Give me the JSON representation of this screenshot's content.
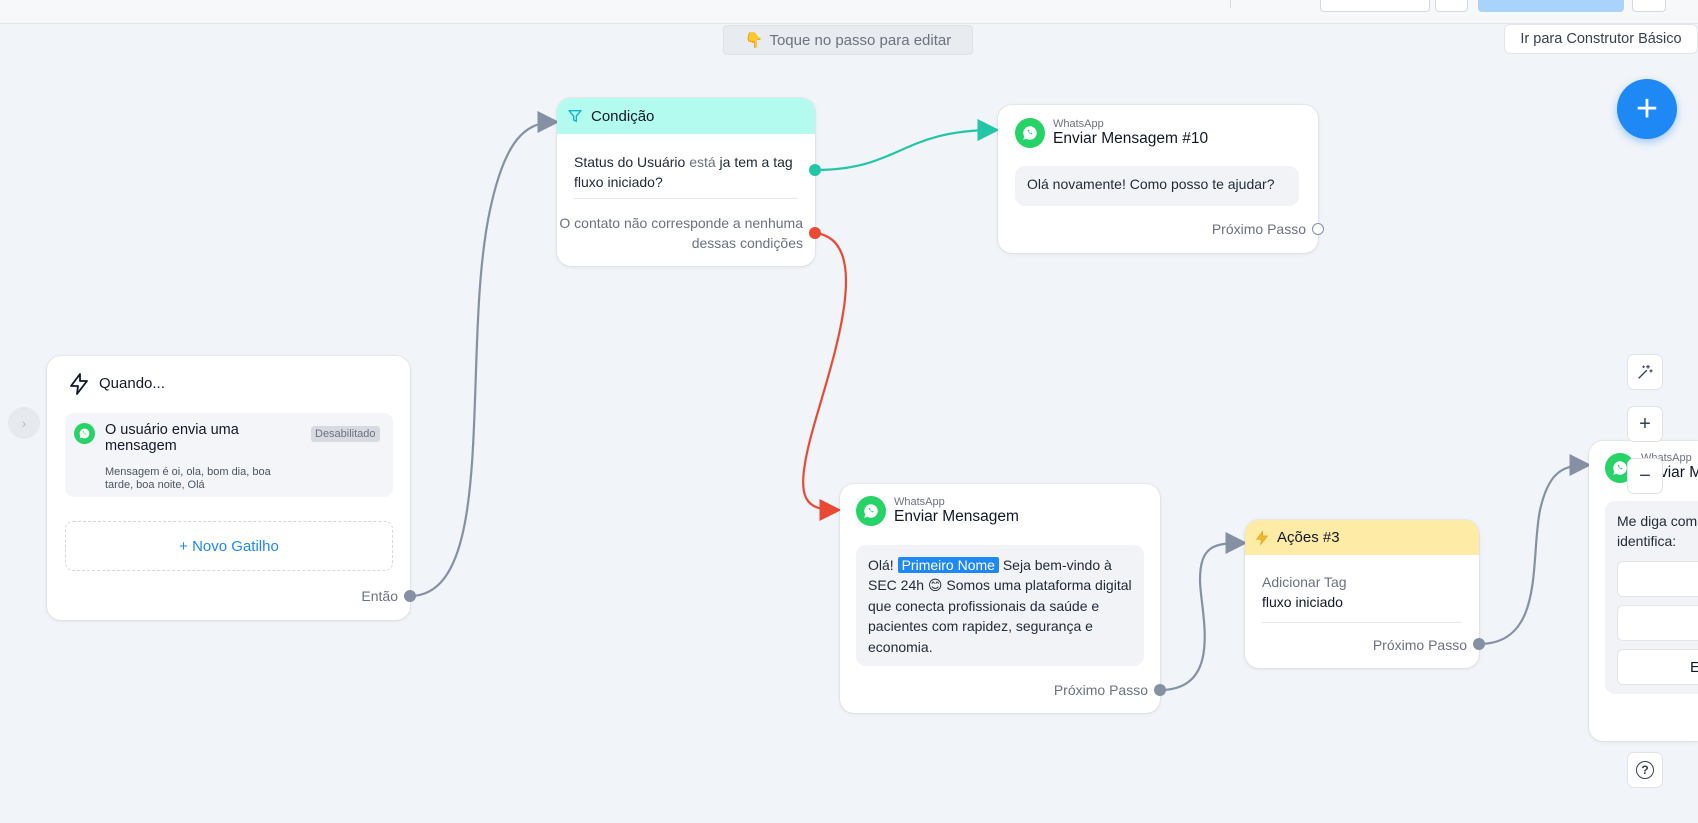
{
  "canvas": {
    "hint": "Toque no passo para editar",
    "hint_icon": "👇",
    "basic_builder_button": "Ir para Construtor Básico",
    "add_button_icon": "+"
  },
  "colors": {
    "accent": "#1e88f5",
    "whatsapp": "#25d366",
    "condition_header": "#b3fbef",
    "actions_header": "#fdeba6",
    "edge_true": "#22c5a5",
    "edge_false": "#ea4a33",
    "edge_default": "#8591a3"
  },
  "trigger": {
    "title": "Quando...",
    "item_title": "O usuário envia uma mensagem",
    "item_badge": "Desabilitado",
    "item_detail": "Mensagem é oi, ola, bom dia, boa tarde, boa noite, Olá",
    "new_trigger": "+ Novo Gatilho",
    "footer": "Então"
  },
  "condition": {
    "title": "Condição",
    "rule_subject": "Status do Usuário",
    "rule_operator": "está",
    "rule_value": "ja tem a tag fluxo iniciado?",
    "fallback": "O contato não corresponde a nenhuma dessas condições"
  },
  "msg10": {
    "kicker": "WhatsApp",
    "title": "Enviar Mensagem #10",
    "text": "Olá novamente! Como posso te ajudar?",
    "footer": "Próximo Passo"
  },
  "msg_main": {
    "kicker": "WhatsApp",
    "title": "Enviar Mensagem",
    "text_before": "Olá!",
    "variable": "Primeiro Nome",
    "text_after": "Seja bem-vindo à SEC 24h 😊 Somos uma plataforma digital que conecta profissionais da saúde e pacientes com rapidez, segurança e economia.",
    "footer": "Próximo Passo"
  },
  "actions": {
    "title": "Ações #3",
    "action_label": "Adicionar Tag",
    "action_value": "fluxo iniciado",
    "footer": "Próximo Passo"
  },
  "msg_partial": {
    "kicker": "WhatsApp",
    "title": "Enviar M",
    "text": "Me diga com identifica:",
    "button3": "En"
  },
  "tools": {
    "magic_icon": "magic-wand-icon",
    "zoom_in": "+",
    "zoom_out": "−",
    "help": "?"
  }
}
